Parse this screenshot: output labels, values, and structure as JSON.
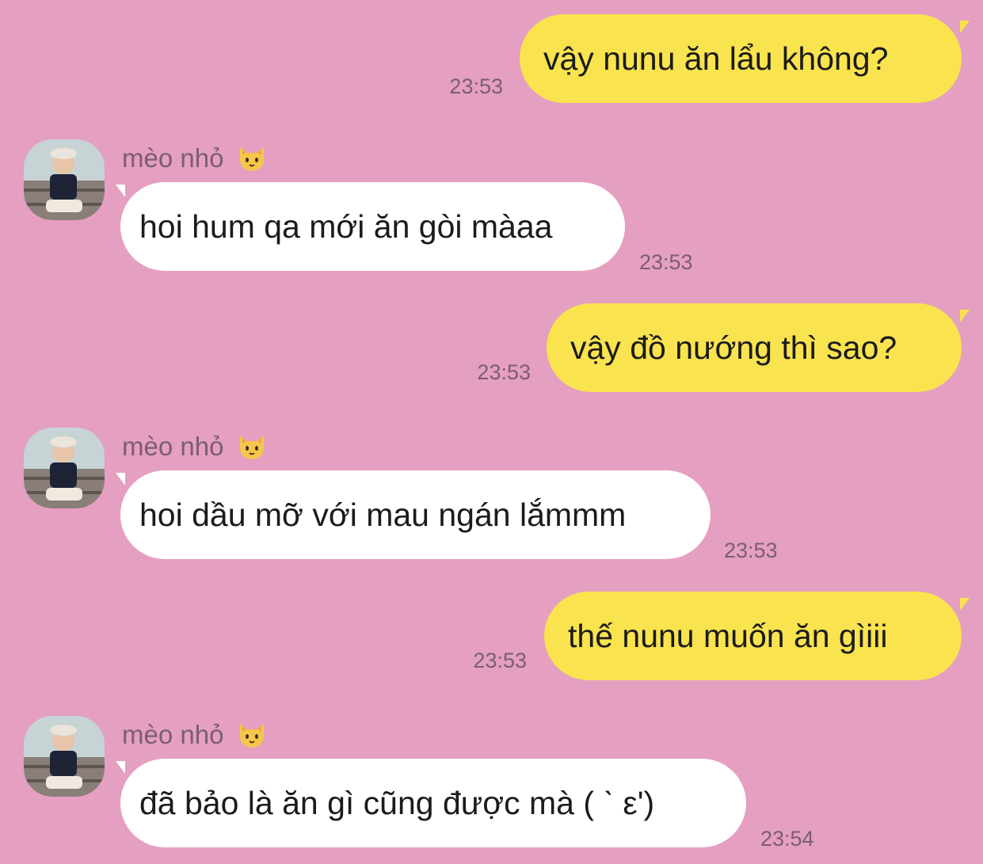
{
  "app": {
    "background_color": "#e59fc0",
    "outgoing_bubble_color": "#f9e34e",
    "incoming_bubble_color": "#ffffff"
  },
  "messages": [
    {
      "direction": "out",
      "text": "vậy nunu ăn lẩu không?",
      "time": "23:53"
    },
    {
      "direction": "in",
      "sender": "mèo nhỏ",
      "sender_emoji": "cat-face-icon",
      "text": "hoi hum qa mới ăn gòi màaa",
      "time": "23:53"
    },
    {
      "direction": "out",
      "text": "vậy đồ nướng thì sao?",
      "time": "23:53"
    },
    {
      "direction": "in",
      "sender": "mèo nhỏ",
      "sender_emoji": "cat-face-icon",
      "text": "hoi dầu mỡ với mau ngán lắmmm",
      "time": "23:53"
    },
    {
      "direction": "out",
      "text": "thế nunu muốn ăn gìiii",
      "time": "23:53"
    },
    {
      "direction": "in",
      "sender": "mèo nhỏ",
      "sender_emoji": "cat-face-icon",
      "text": "đã bảo là ăn gì cũng được mà ( ˋ ε')",
      "time": "23:54"
    }
  ]
}
